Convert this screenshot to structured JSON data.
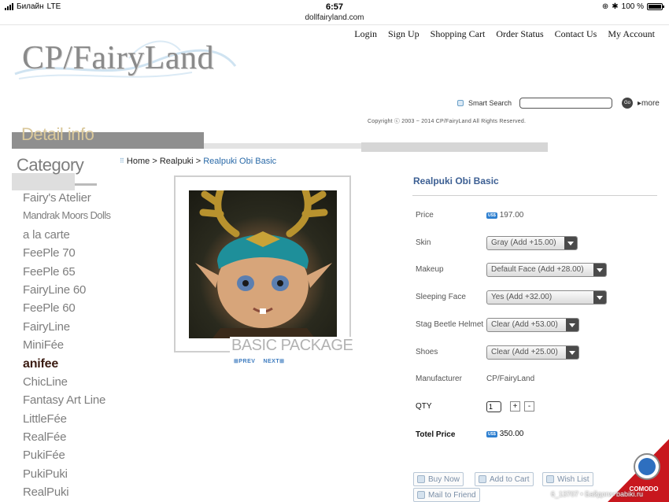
{
  "status_bar": {
    "carrier": "Билайн",
    "network": "LTE",
    "time": "6:57",
    "url": "dollfairyland.com",
    "battery": "100 %"
  },
  "header": {
    "nav": [
      "Login",
      "Sign Up",
      "Shopping Cart",
      "Order Status",
      "Contact Us",
      "My Account"
    ],
    "logo": "CP/FairyLand",
    "search_label": "Smart Search",
    "search_value": "",
    "go_label": "Go",
    "more_label": "▸more",
    "copyright": "Copyright ⓒ 2003 ~ 2014 CP/FairyLand All Rights Reserved."
  },
  "section_title": "Detail info",
  "category": {
    "title": "Category",
    "items": [
      "Fairy's Atelier",
      "Mandrak Moors Dolls",
      "a la carte",
      "FeePle 70",
      "FeePle 65",
      "FairyLine 60",
      "FeePle 60",
      "FairyLine",
      "MiniFée",
      "anifee",
      "ChicLine",
      "Fantasy Art Line",
      "LittleFée",
      "RealFée",
      "PukiFée",
      "PukiPuki",
      "RealPuki"
    ]
  },
  "breadcrumb": {
    "home": "Home",
    "sep": ">",
    "parent": "Realpuki",
    "current": "Realpuki Obi Basic"
  },
  "gallery": {
    "caption": "BASIC PACKAGE",
    "prev": "PREV",
    "next": "NEXT"
  },
  "product": {
    "title": "Realpuki Obi Basic",
    "currency_badge": "US$",
    "price_label": "Price",
    "price": "197.00",
    "options": [
      {
        "label": "Skin",
        "value": "Gray (Add +15.00)"
      },
      {
        "label": "Makeup",
        "value": "Default Face (Add +28.00)"
      },
      {
        "label": "Sleeping Face",
        "value": "Yes (Add +32.00)"
      },
      {
        "label": "Stag Beetle Helmet",
        "value": "Clear (Add +53.00)"
      },
      {
        "label": "Shoes",
        "value": "Clear (Add +25.00)"
      }
    ],
    "manufacturer_label": "Manufacturer",
    "manufacturer": "CP/FairyLand",
    "qty_label": "QTY",
    "qty": "1",
    "plus": "+",
    "minus": "-",
    "total_label": "Totel Price",
    "total": "350.00"
  },
  "buttons": {
    "buy_now": "Buy Now",
    "add_to_cart": "Add to Cart",
    "wish_list": "Wish List",
    "mail_to_friend": "Mail to Friend"
  },
  "seal": "COMODO",
  "watermark": "6_13707 • Байдоги+babiki.ru"
}
